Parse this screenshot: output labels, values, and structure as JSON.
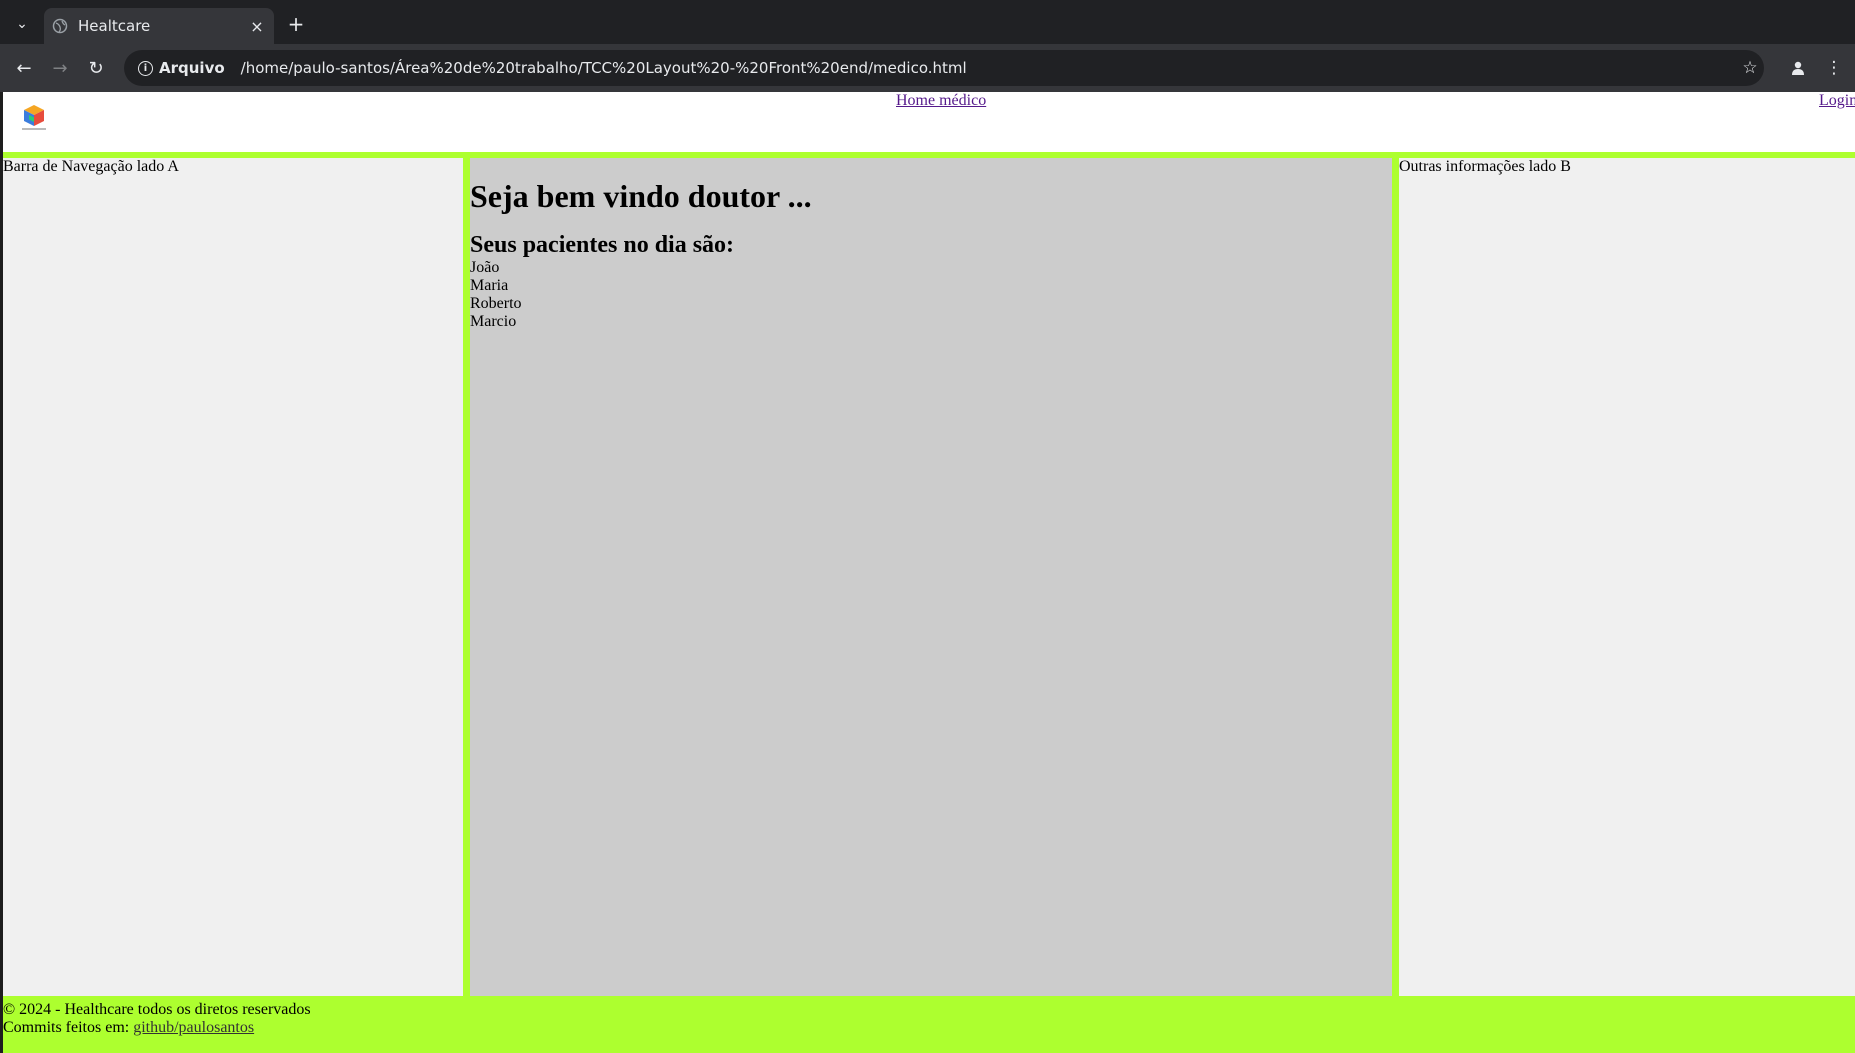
{
  "browser": {
    "tab_title": "Healtcare",
    "tab_close": "×",
    "new_tab": "+",
    "site_chip": "Arquivo",
    "url": "/home/paulo-santos/Área%20de%20trabalho/TCC%20Layout%20-%20Front%20end/medico.html"
  },
  "header": {
    "nav_home": "Home médico",
    "nav_login": "Login"
  },
  "sidebar_a": {
    "label": "Barra de Navegação lado A"
  },
  "main": {
    "welcome": "Seja bem vindo doutor ...",
    "patients_heading": "Seus pacientes no dia são:",
    "patients": [
      "João",
      "Maria",
      "Roberto",
      "Marcio"
    ]
  },
  "sidebar_b": {
    "label": "Outras informações lado B"
  },
  "footer": {
    "copyright": "© 2024 - Healthcare todos os diretos reservados",
    "commits_prefix": "Commits feitos em:",
    "commits_link": "github/paulosantos"
  },
  "colors": {
    "page_accent": "#adff2f",
    "side_panels": "#f0f0f0",
    "main_panel": "#cccccc",
    "link_visited": "#551a8b"
  },
  "icons": {
    "tab_list": "chevron-down-icon",
    "tab_favicon": "globe-icon",
    "back": "arrow-left-icon",
    "forward": "arrow-right-icon",
    "reload": "reload-icon",
    "site_info": "info-icon",
    "bookmark": "star-icon",
    "profile": "person-icon",
    "menu": "kebab-menu-icon",
    "logo": "cube-logo-icon"
  }
}
